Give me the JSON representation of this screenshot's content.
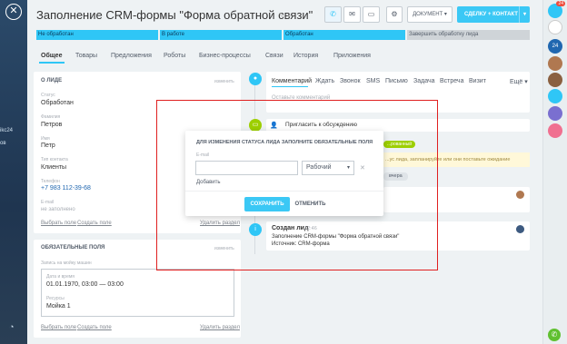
{
  "header": {
    "title": "Заполнение CRM-формы \"Форма обратной связи\"",
    "document_label": "ДОКУМЕНТ",
    "deal_contact_label": "СДЕЛКУ + КОНТАКТ"
  },
  "left_strip": {
    "text1": "ikc24",
    "text2": "ов"
  },
  "stages": [
    "Не обработан",
    "В работе",
    "Обработан",
    "Завершить обработку лида"
  ],
  "tabs": [
    "Общее",
    "Товары",
    "Предложения",
    "Роботы",
    "Бизнес-процессы",
    "Связи",
    "История",
    "Приложения"
  ],
  "about": {
    "title": "О ЛИДЕ",
    "action": "изменить",
    "fields": [
      {
        "label": "Статус",
        "value": "Обработан"
      },
      {
        "label": "Фамилия",
        "value": "Петров"
      },
      {
        "label": "Имя",
        "value": "Петр"
      },
      {
        "label": "Тип контакта",
        "value": "Клиенты"
      },
      {
        "label": "Телефон",
        "value": "+7 983 112-39-68"
      },
      {
        "label": "E-mail",
        "value": "не заполнено"
      }
    ],
    "footer_select": "Выбрать поле",
    "footer_create": "Создать поле",
    "footer_delete": "Удалить раздел"
  },
  "required": {
    "title": "ОБЯЗАТЕЛЬНЫЕ ПОЛЯ",
    "action": "изменить",
    "booking_label": "Запись на мойку машин",
    "date_label": "Дата и время",
    "date_value": "01.01.1970, 03:00 — 03:00",
    "resource_label": "Ресурсы",
    "resource_value": "Мойка 1",
    "footer_select": "Выбрать поле",
    "footer_create": "Создать поле",
    "footer_delete": "Удалить раздел"
  },
  "comment_tabs": [
    "Комментарий",
    "Ждать",
    "Звонок",
    "SMS",
    "Письмо",
    "Задача",
    "Встреча",
    "Визит",
    "Ещё"
  ],
  "comment_placeholder": "Оставьте комментарий",
  "invite": "Пригласить к обсуждению",
  "status_chip": "...рованный",
  "hint_text": "...ус лида, запланируйте или они поставьте ожидание",
  "yesterday": "вчера",
  "created": {
    "title": "Создан лид",
    "time": "12:46",
    "line1": "Заполнение CRM-формы \"Форма обратной связи\"",
    "line2": "Источник: CRM-форма"
  },
  "modal": {
    "title": "ДЛЯ ИЗМЕНЕНИЯ СТАТУСА ЛИДА ЗАПОЛНИТЕ ОБЯЗАТЕЛЬНЫЕ ПОЛЯ",
    "email_label": "E-mail",
    "email_value": "",
    "type_value": "Рабочий",
    "add_label": "Добавить",
    "save_label": "СОХРАНИТЬ",
    "cancel_label": "ОТМЕНИТЬ"
  },
  "right_bar": {
    "badge": "24"
  }
}
